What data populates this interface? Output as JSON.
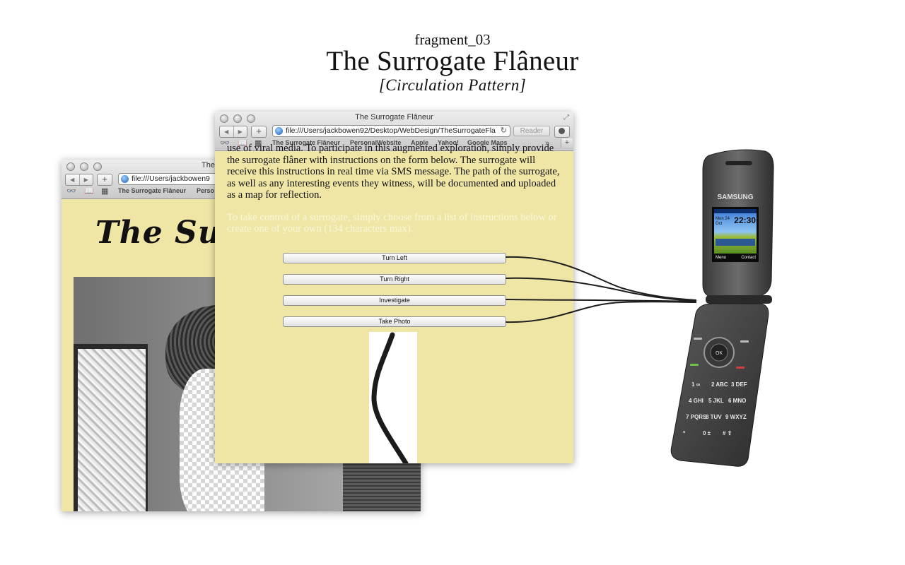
{
  "header": {
    "fragment": "fragment_03",
    "title": "The Surrogate Flâneur",
    "subtitle": "[Circulation Pattern]"
  },
  "front_window": {
    "title": "The Surrogate Flâneur",
    "url": "file:///Users/jackbowen92/Desktop/WebDesign/TheSurrogateFla",
    "reader_label": "Reader",
    "bookmarks": [
      "The Surrogate Flâneur",
      "PersonalWebsite",
      "Apple",
      "Yahoo!",
      "Google Maps"
    ],
    "paragraph_1": "use of viral media. To participate in this augmented exploration, simply provide the surrogate flâner with instructions on the form below. The surrogate will receive this instructions in real time via SMS message. The path of the surrogate, as well as any interesting events they witness, will be documented and uploaded as a map for reflection.",
    "paragraph_2": "To take control of a surrogate, simply choose from a list of instructions below or create one of your own (134 characters max).",
    "buttons": [
      "Turn Left",
      "Turn Right",
      "Investigate",
      "Take Photo"
    ]
  },
  "back_window": {
    "title": "The",
    "url": "file:///Users/jackbowen9",
    "bookmarks": [
      "The Surrogate Flâneur",
      "Perso"
    ],
    "script_heading": "The Surr"
  },
  "phone": {
    "brand": "SAMSUNG",
    "date_line1": "Mon 24",
    "date_line2": "Oct",
    "time": "22:30",
    "softkey_left": "Menu",
    "softkey_right": "Contact",
    "ok_label": "OK",
    "keys": [
      "1 ∞",
      "2 ABC",
      "3 DEF",
      "4 GHI",
      "5 JKL",
      "6 MNO",
      "7 PQRS",
      "8 TUV",
      "9 WXYZ",
      "*",
      "0 ±",
      "# ⇧"
    ]
  },
  "icons": [
    "back-arrow-icon",
    "forward-arrow-icon",
    "add-tab-icon",
    "globe-icon",
    "reload-icon",
    "downloads-icon",
    "reading-list-icon",
    "bookmarks-book-icon",
    "top-sites-grid-icon",
    "resize-icon"
  ]
}
